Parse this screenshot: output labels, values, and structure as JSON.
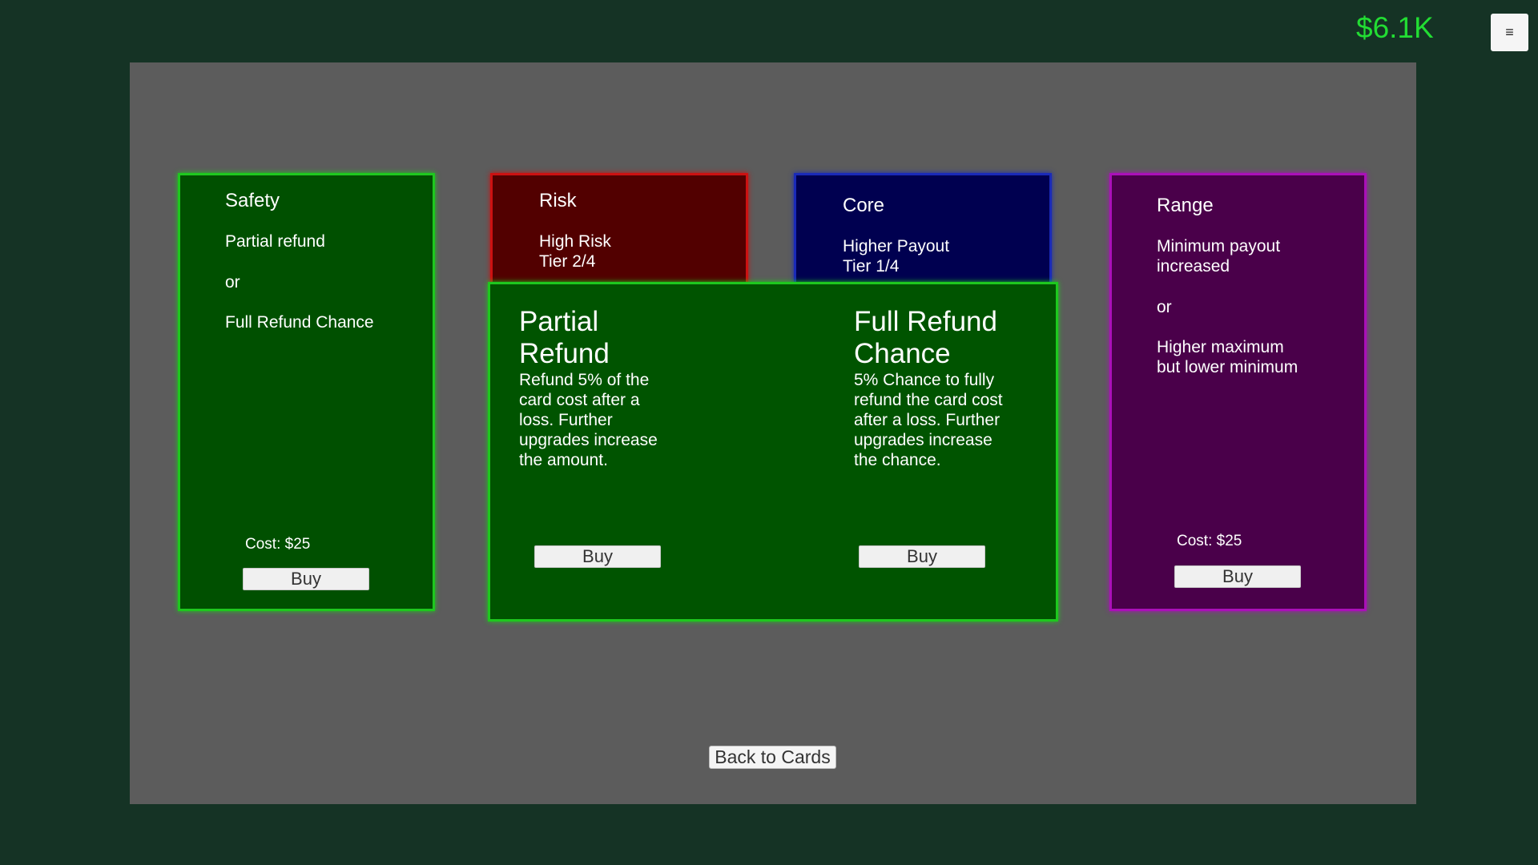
{
  "hud": {
    "money": "$6.1K",
    "menu_icon": "≡"
  },
  "cards": {
    "safety": {
      "title": "Safety",
      "line1": "Partial refund",
      "line2": "or",
      "line3": "Full Refund Chance",
      "cost": "Cost: $25",
      "buy": "Buy",
      "color": "#005000"
    },
    "risk": {
      "title": "Risk",
      "body": "High Risk\nTier 2/4",
      "color": "#520000"
    },
    "core": {
      "title": "Core",
      "body": "Higher Payout\nTier 1/4",
      "color": "#000050"
    },
    "range": {
      "title": "Range",
      "line1": "Minimum payout\nincreased",
      "line2": "or",
      "line3": "Higher maximum\nbut lower minimum",
      "cost": "Cost: $25",
      "buy": "Buy",
      "color": "#4a004a"
    }
  },
  "popup": {
    "option1": {
      "title": "Partial\nRefund",
      "desc": "Refund 5% of the\ncard cost after a\nloss. Further\nupgrades increase\nthe amount.",
      "buy": "Buy"
    },
    "option2": {
      "title": "Full Refund\nChance",
      "desc": "5% Chance to fully\nrefund the card cost\nafter a loss. Further\nupgrades increase\nthe chance.",
      "buy": "Buy"
    }
  },
  "footer": {
    "back": "Back to Cards"
  }
}
